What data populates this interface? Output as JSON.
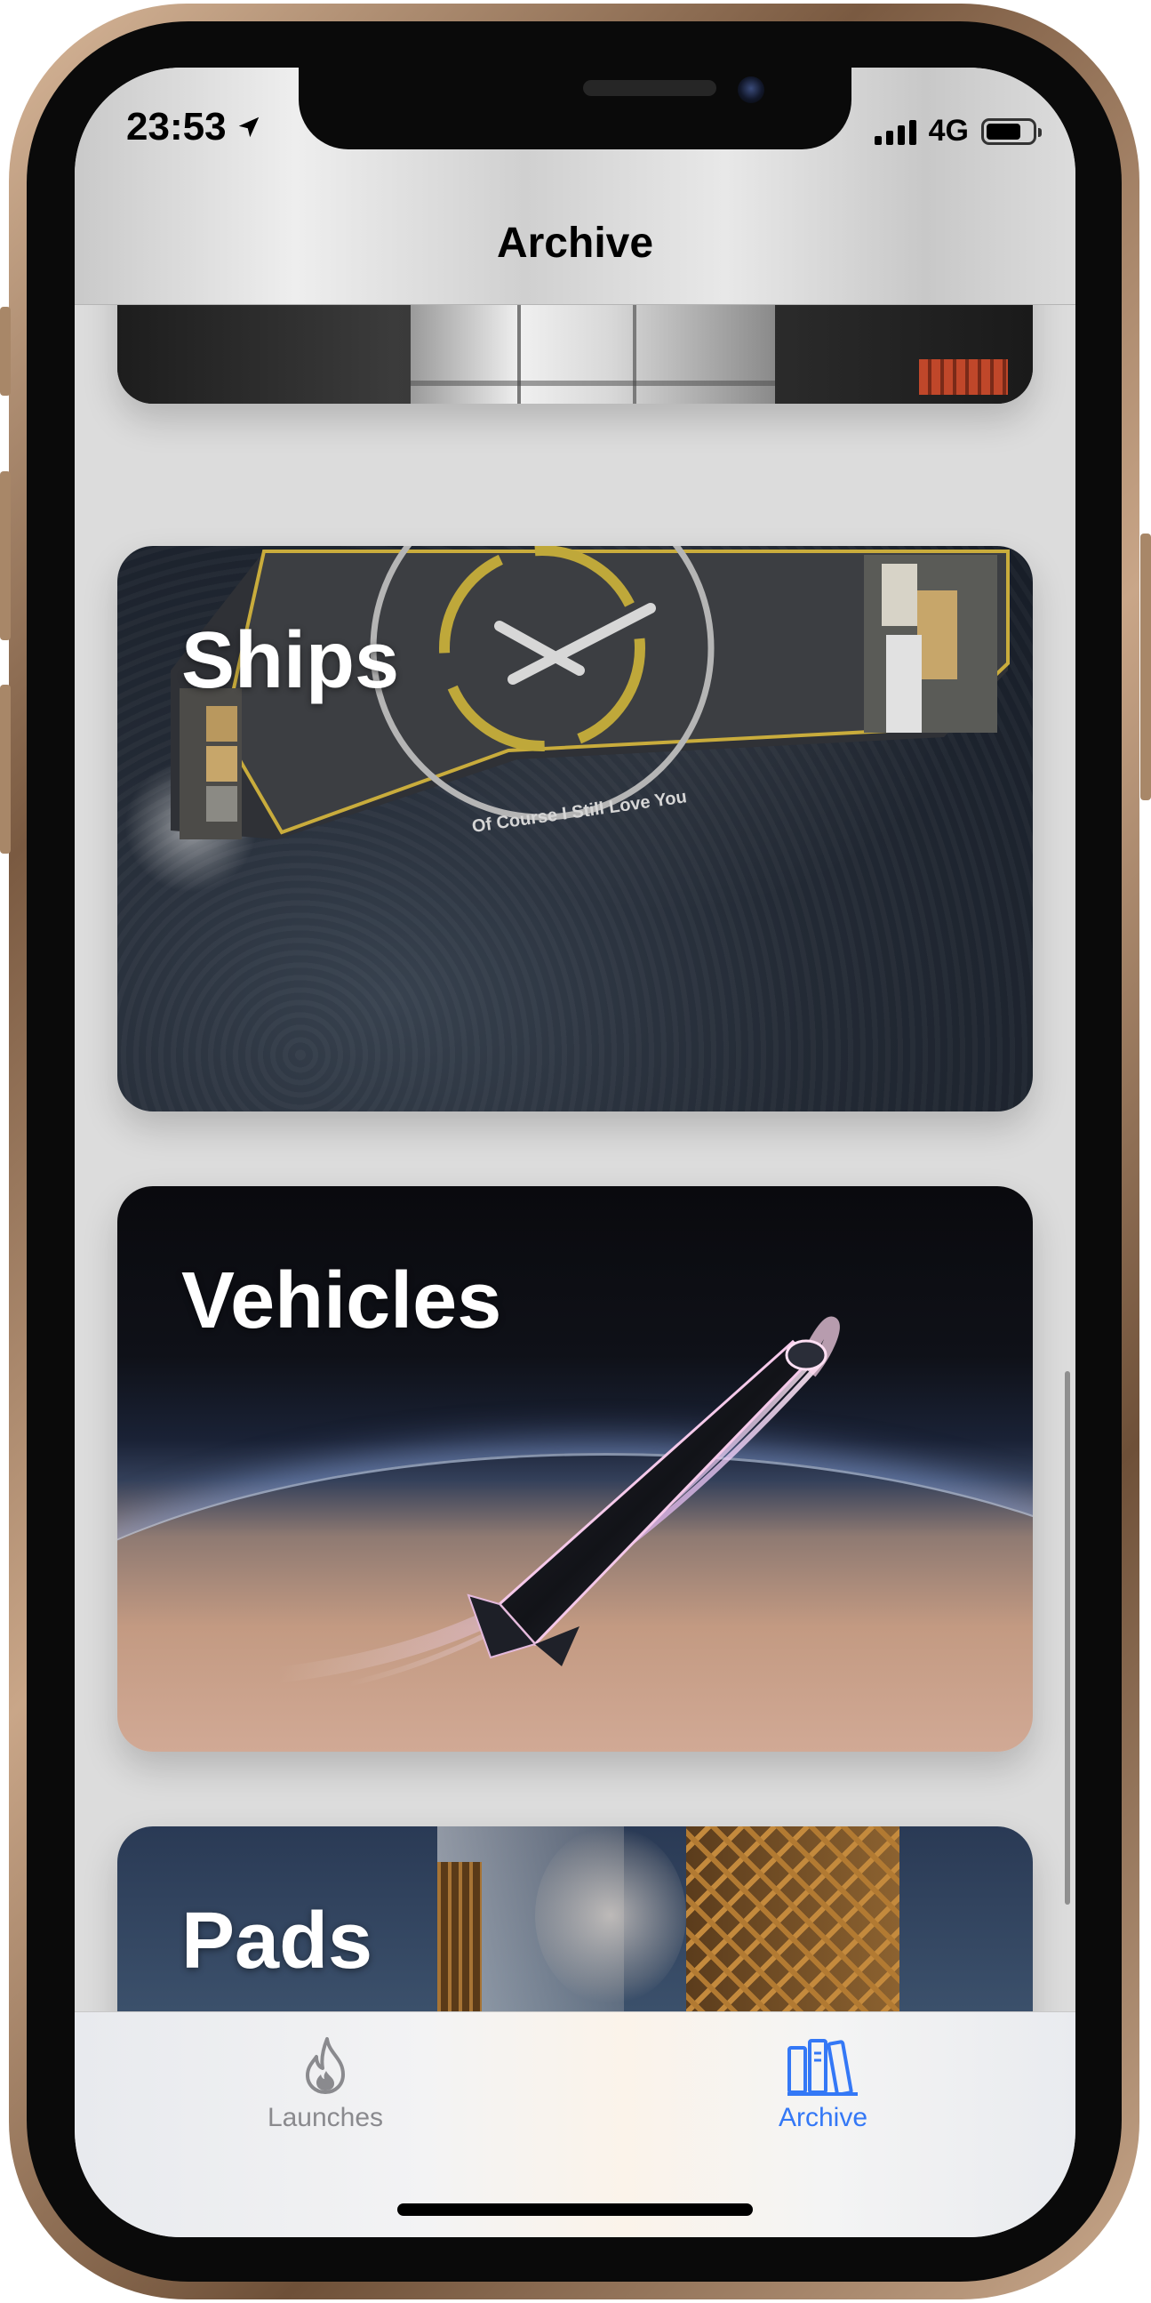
{
  "status_bar": {
    "time": "23:53",
    "network": "4G",
    "battery_level": 0.75,
    "location_icon": "location-arrow-icon",
    "signal_bars": 4
  },
  "nav": {
    "title": "Archive"
  },
  "cards": [
    {
      "title": "",
      "image": "rocket-launch-pad-photo"
    },
    {
      "title": "Ships",
      "image": "drone-ship-photo",
      "caption": "Of Course I Still Love You"
    },
    {
      "title": "Vehicles",
      "image": "starship-reentry-render"
    },
    {
      "title": "Pads",
      "image": "launch-tower-photo"
    }
  ],
  "tabbar": {
    "tabs": [
      {
        "label": "Launches",
        "icon": "flame-icon",
        "selected": false
      },
      {
        "label": "Archive",
        "icon": "books-icon",
        "selected": true
      }
    ]
  },
  "colors": {
    "accent": "#3478f6",
    "inactive": "#8a8a8e",
    "title_text": "#ffffff"
  }
}
